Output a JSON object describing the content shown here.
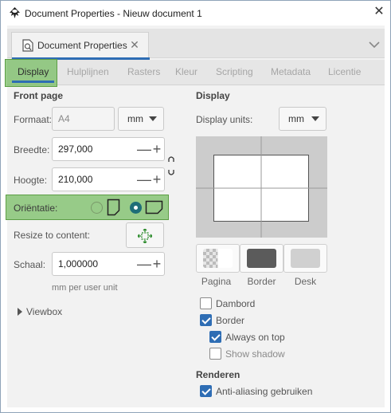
{
  "window": {
    "title": "Document Properties - Nieuw document 1",
    "icons": {
      "app": "inkscape-logo-icon",
      "close": "close-icon"
    }
  },
  "doc_tab": {
    "label": "Document Properties",
    "close_glyph": "✕",
    "icon": "document-properties-icon"
  },
  "tab_menu_glyph": "⌄",
  "subtabs": [
    {
      "label": "Display",
      "active": true
    },
    {
      "label": "Hulplijnen",
      "active": false
    },
    {
      "label": "Rasters",
      "active": false
    },
    {
      "label": "Kleur",
      "active": false
    },
    {
      "label": "Scripting",
      "active": false
    },
    {
      "label": "Metadata",
      "active": false
    },
    {
      "label": "Licentie",
      "active": false
    }
  ],
  "front_page": {
    "title": "Front page",
    "format_label": "Formaat:",
    "format_value": "A4",
    "format_unit": "mm",
    "width_label": "Breedte:",
    "width_value": "297,000",
    "height_label": "Hoogte:",
    "height_value": "210,000",
    "orientation_label": "Oriëntatie:",
    "orientation_selected": "landscape",
    "resize_label": "Resize to content:",
    "scale_label": "Schaal:",
    "scale_value": "1,000000",
    "scale_unit_note": "mm per user unit",
    "viewbox_label": "Viewbox",
    "spin_minus": "—",
    "spin_plus": "+"
  },
  "display": {
    "title": "Display",
    "units_label": "Display units:",
    "units_value": "mm",
    "swatches": [
      {
        "label": "Pagina",
        "color": "#ffffff"
      },
      {
        "label": "Border",
        "color": "#5b5b5b"
      },
      {
        "label": "Desk",
        "color": "#d0d0d0"
      }
    ],
    "checkboxes": {
      "checkerboard": {
        "label": "Dambord",
        "checked": false
      },
      "border": {
        "label": "Border",
        "checked": true
      },
      "always_on_top": {
        "label": "Always on top",
        "checked": true
      },
      "show_shadow": {
        "label": "Show shadow",
        "checked": false
      }
    },
    "render_title": "Renderen",
    "antialias": {
      "label": "Anti-aliasing gebruiken",
      "checked": true
    }
  },
  "colors": {
    "accent": "#2e6db4",
    "highlight": "#78be64",
    "radio_selected": "#1f6e78"
  }
}
